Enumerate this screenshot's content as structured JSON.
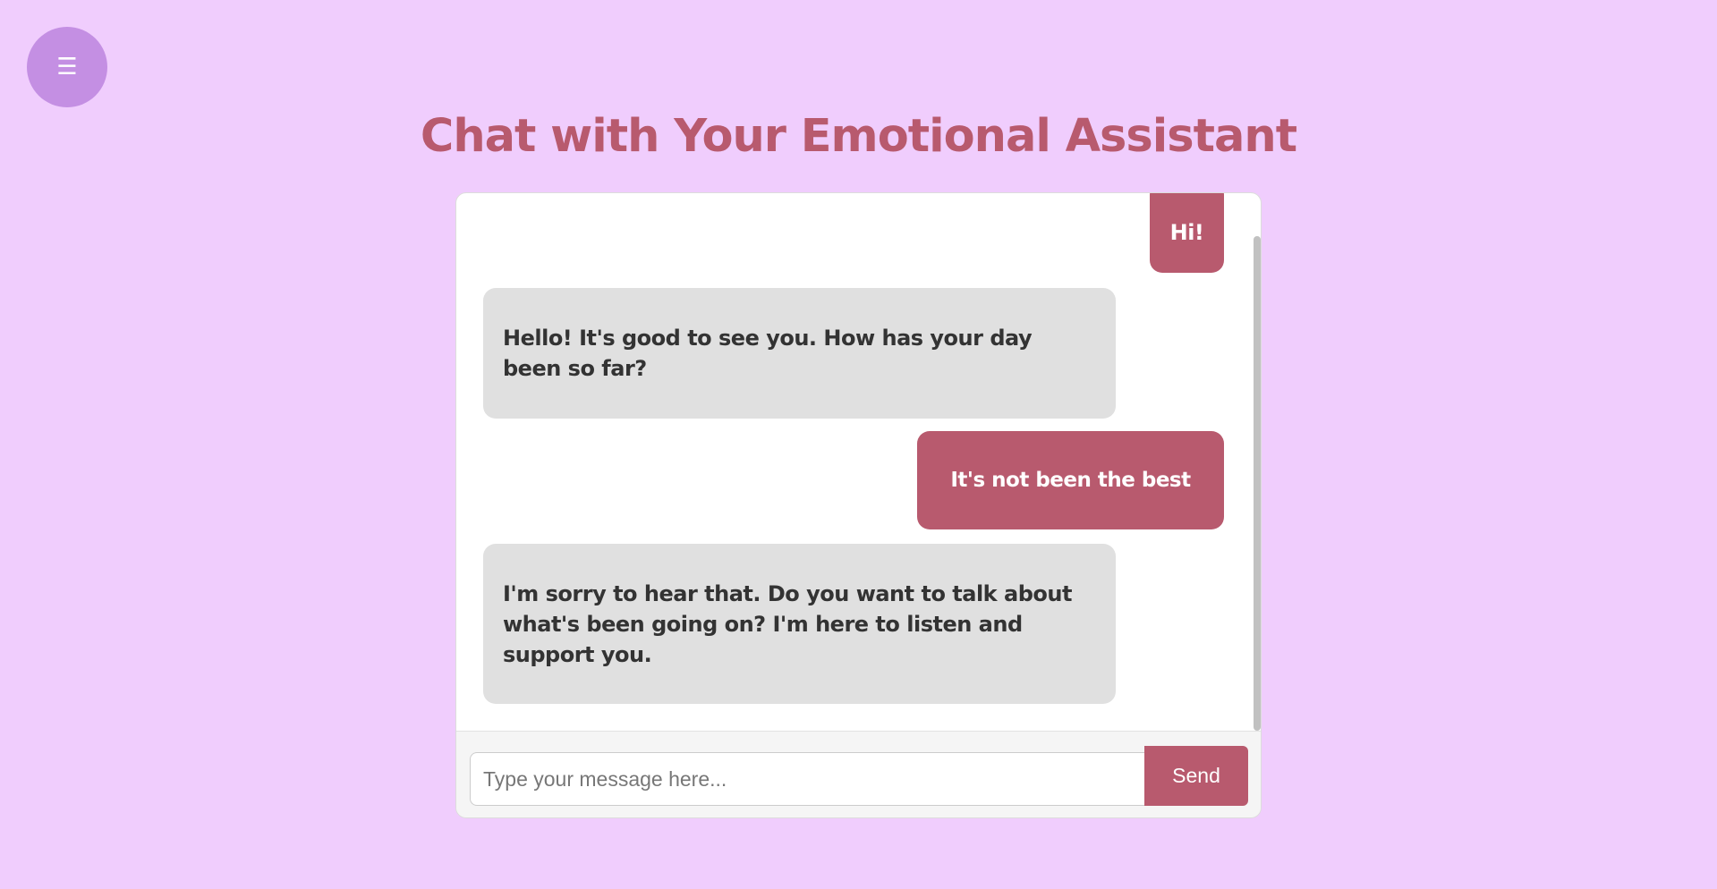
{
  "menu": {
    "icon": "hamburger-menu-icon",
    "glyph": "☰"
  },
  "header": {
    "title": "Chat with Your Emotional Assistant"
  },
  "chat": {
    "messages": [
      {
        "sender": "user",
        "text": "Hi!"
      },
      {
        "sender": "assistant",
        "text": "Hello! It's good to see you. How has your day been so far?"
      },
      {
        "sender": "user",
        "text": "It's not been the best"
      },
      {
        "sender": "assistant",
        "text": "I'm sorry to hear that. Do you want to talk about what's been going on? I'm here to listen and support you."
      }
    ]
  },
  "composer": {
    "placeholder": "Type your message here...",
    "value": "",
    "send_label": "Send"
  },
  "colors": {
    "background": "#f0cdfd",
    "accent": "#b85a6e",
    "menu_button": "#c48fe3",
    "assistant_bubble": "#e0e0e0",
    "assistant_text": "#333333"
  }
}
